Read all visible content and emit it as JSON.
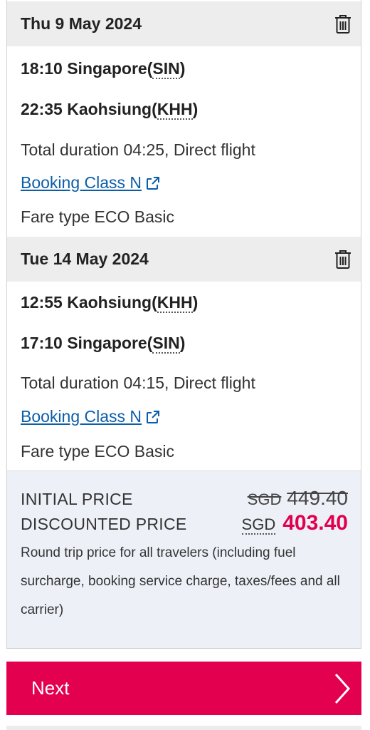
{
  "segments": [
    {
      "date": "Thu 9 May 2024",
      "departure": {
        "time": "18:10",
        "city": "Singapore",
        "code": "SIN"
      },
      "arrival": {
        "time": "22:35",
        "city": "Kaohsiung",
        "code": "KHH"
      },
      "duration": "Total duration 04:25, Direct flight",
      "booking_class": "Booking Class N",
      "fare_type": "Fare type ECO Basic"
    },
    {
      "date": "Tue 14 May 2024",
      "departure": {
        "time": "12:55",
        "city": "Kaohsiung",
        "code": "KHH"
      },
      "arrival": {
        "time": "17:10",
        "city": "Singapore",
        "code": "SIN"
      },
      "duration": "Total duration 04:15, Direct flight",
      "booking_class": "Booking Class N",
      "fare_type": "Fare type ECO Basic"
    }
  ],
  "pricing": {
    "initial_label": "INITIAL PRICE",
    "initial_currency": "SGD",
    "initial_amount": "449.40",
    "discounted_label": "DISCOUNTED PRICE",
    "discounted_currency": "SGD",
    "discounted_amount": "403.40",
    "note": "Round trip price for all travelers (including fuel surcharge, booking service charge, taxes/fees and all carrier)"
  },
  "next_button": {
    "label": "Next"
  },
  "colors": {
    "accent": "#e3004f",
    "link": "#0b5ea8",
    "header_bg": "#ededed",
    "price_bg": "#eef0f8"
  },
  "icons": {
    "delete": "trash-icon",
    "external": "external-link-icon",
    "next": "chevron-right-icon"
  }
}
